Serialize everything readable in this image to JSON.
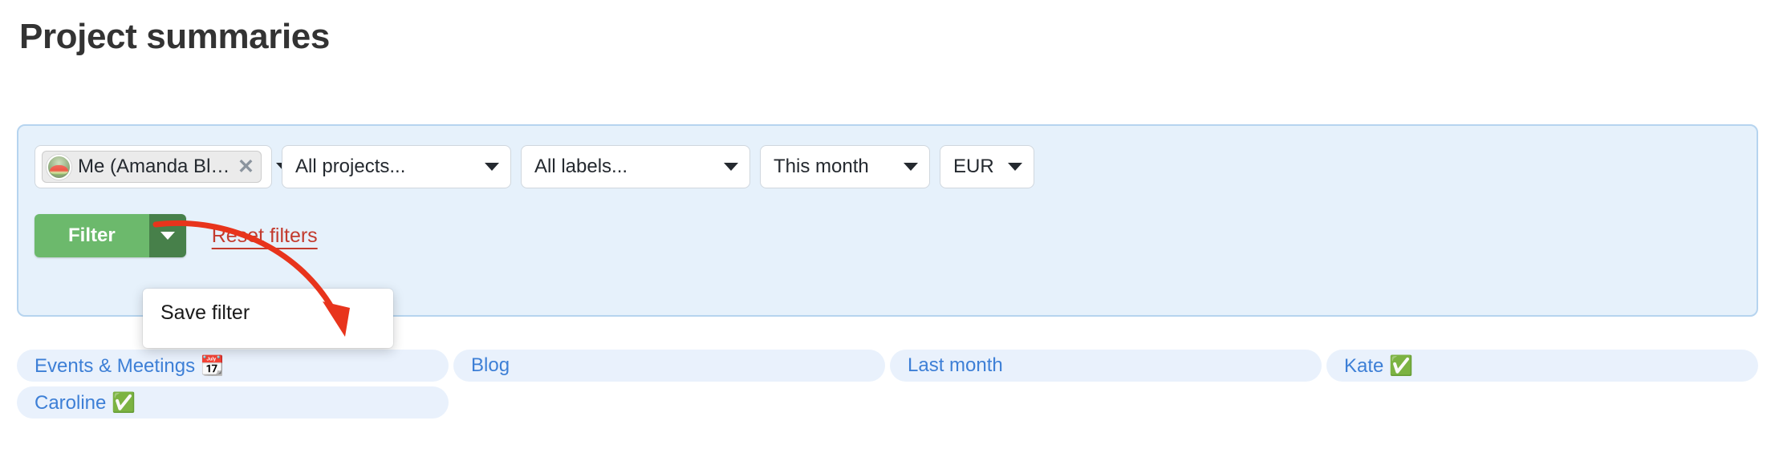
{
  "page": {
    "title": "Project summaries"
  },
  "filters": {
    "user_select": {
      "token_label": "Me (Amanda Blue)",
      "remove_glyph": "✕",
      "avatar_alt": "Amanda Blue avatar"
    },
    "projects_select": {
      "value": "All projects..."
    },
    "labels_select": {
      "value": "All labels..."
    },
    "period_select": {
      "value": "This month"
    },
    "currency_select": {
      "value": "EUR"
    },
    "filter_button": {
      "label": "Filter"
    },
    "reset_link": {
      "label": "Reset filters"
    }
  },
  "dropdown": {
    "items": [
      {
        "label": "Save filter"
      }
    ]
  },
  "saved_filters": [
    {
      "label": "Events & Meetings 📆"
    },
    {
      "label": "Blog"
    },
    {
      "label": "Last month"
    },
    {
      "label": "Kate ✅"
    },
    {
      "label": "Caroline ✅"
    }
  ],
  "colors": {
    "panel_bg": "#e6f1fb",
    "panel_border": "#b6d4ef",
    "filter_green": "#6cb96c",
    "filter_green_dark": "#47804a",
    "reset_red": "#c33b2e",
    "chip_bg": "#e9f1fc",
    "chip_text": "#3d7fd6",
    "annotation_red": "#e8341c"
  }
}
